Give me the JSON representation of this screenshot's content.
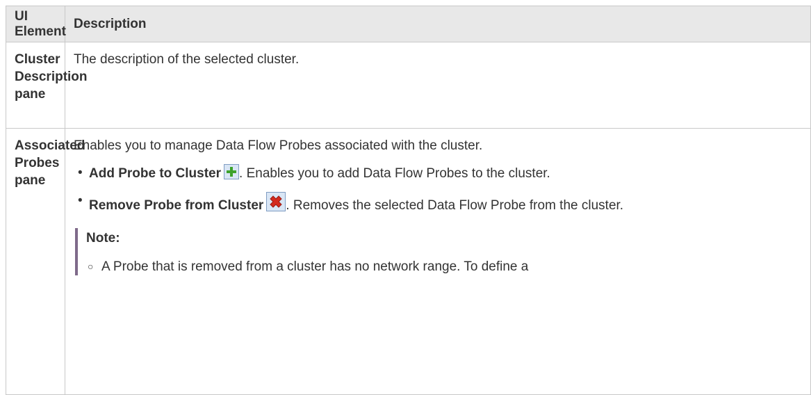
{
  "table": {
    "headers": {
      "element": "UI Element",
      "description": "Description"
    },
    "rows": [
      {
        "element": "Cluster Description pane",
        "description": "The description of the selected cluster."
      },
      {
        "element": "Associated Probes pane",
        "intro": "Enables you to manage Data Flow Probes associated with the cluster.",
        "items": [
          {
            "label": "Add Probe to Cluster",
            "icon": "add-icon",
            "text": ". Enables you to add Data Flow Probes to the cluster."
          },
          {
            "label": "Remove Probe from Cluster",
            "icon": "remove-icon",
            "text": ". Removes the selected Data Flow Probe from the cluster."
          }
        ],
        "note": {
          "title": "Note:",
          "items": [
            "A Probe that is removed from a cluster has no network range. To define a"
          ]
        }
      }
    ]
  },
  "colors": {
    "header_bg": "#e8e8e8",
    "border": "#c8c8c8",
    "note_bar": "#7f6a8a",
    "add_icon_green": "#3da22b",
    "remove_icon_red": "#d42a1e"
  }
}
